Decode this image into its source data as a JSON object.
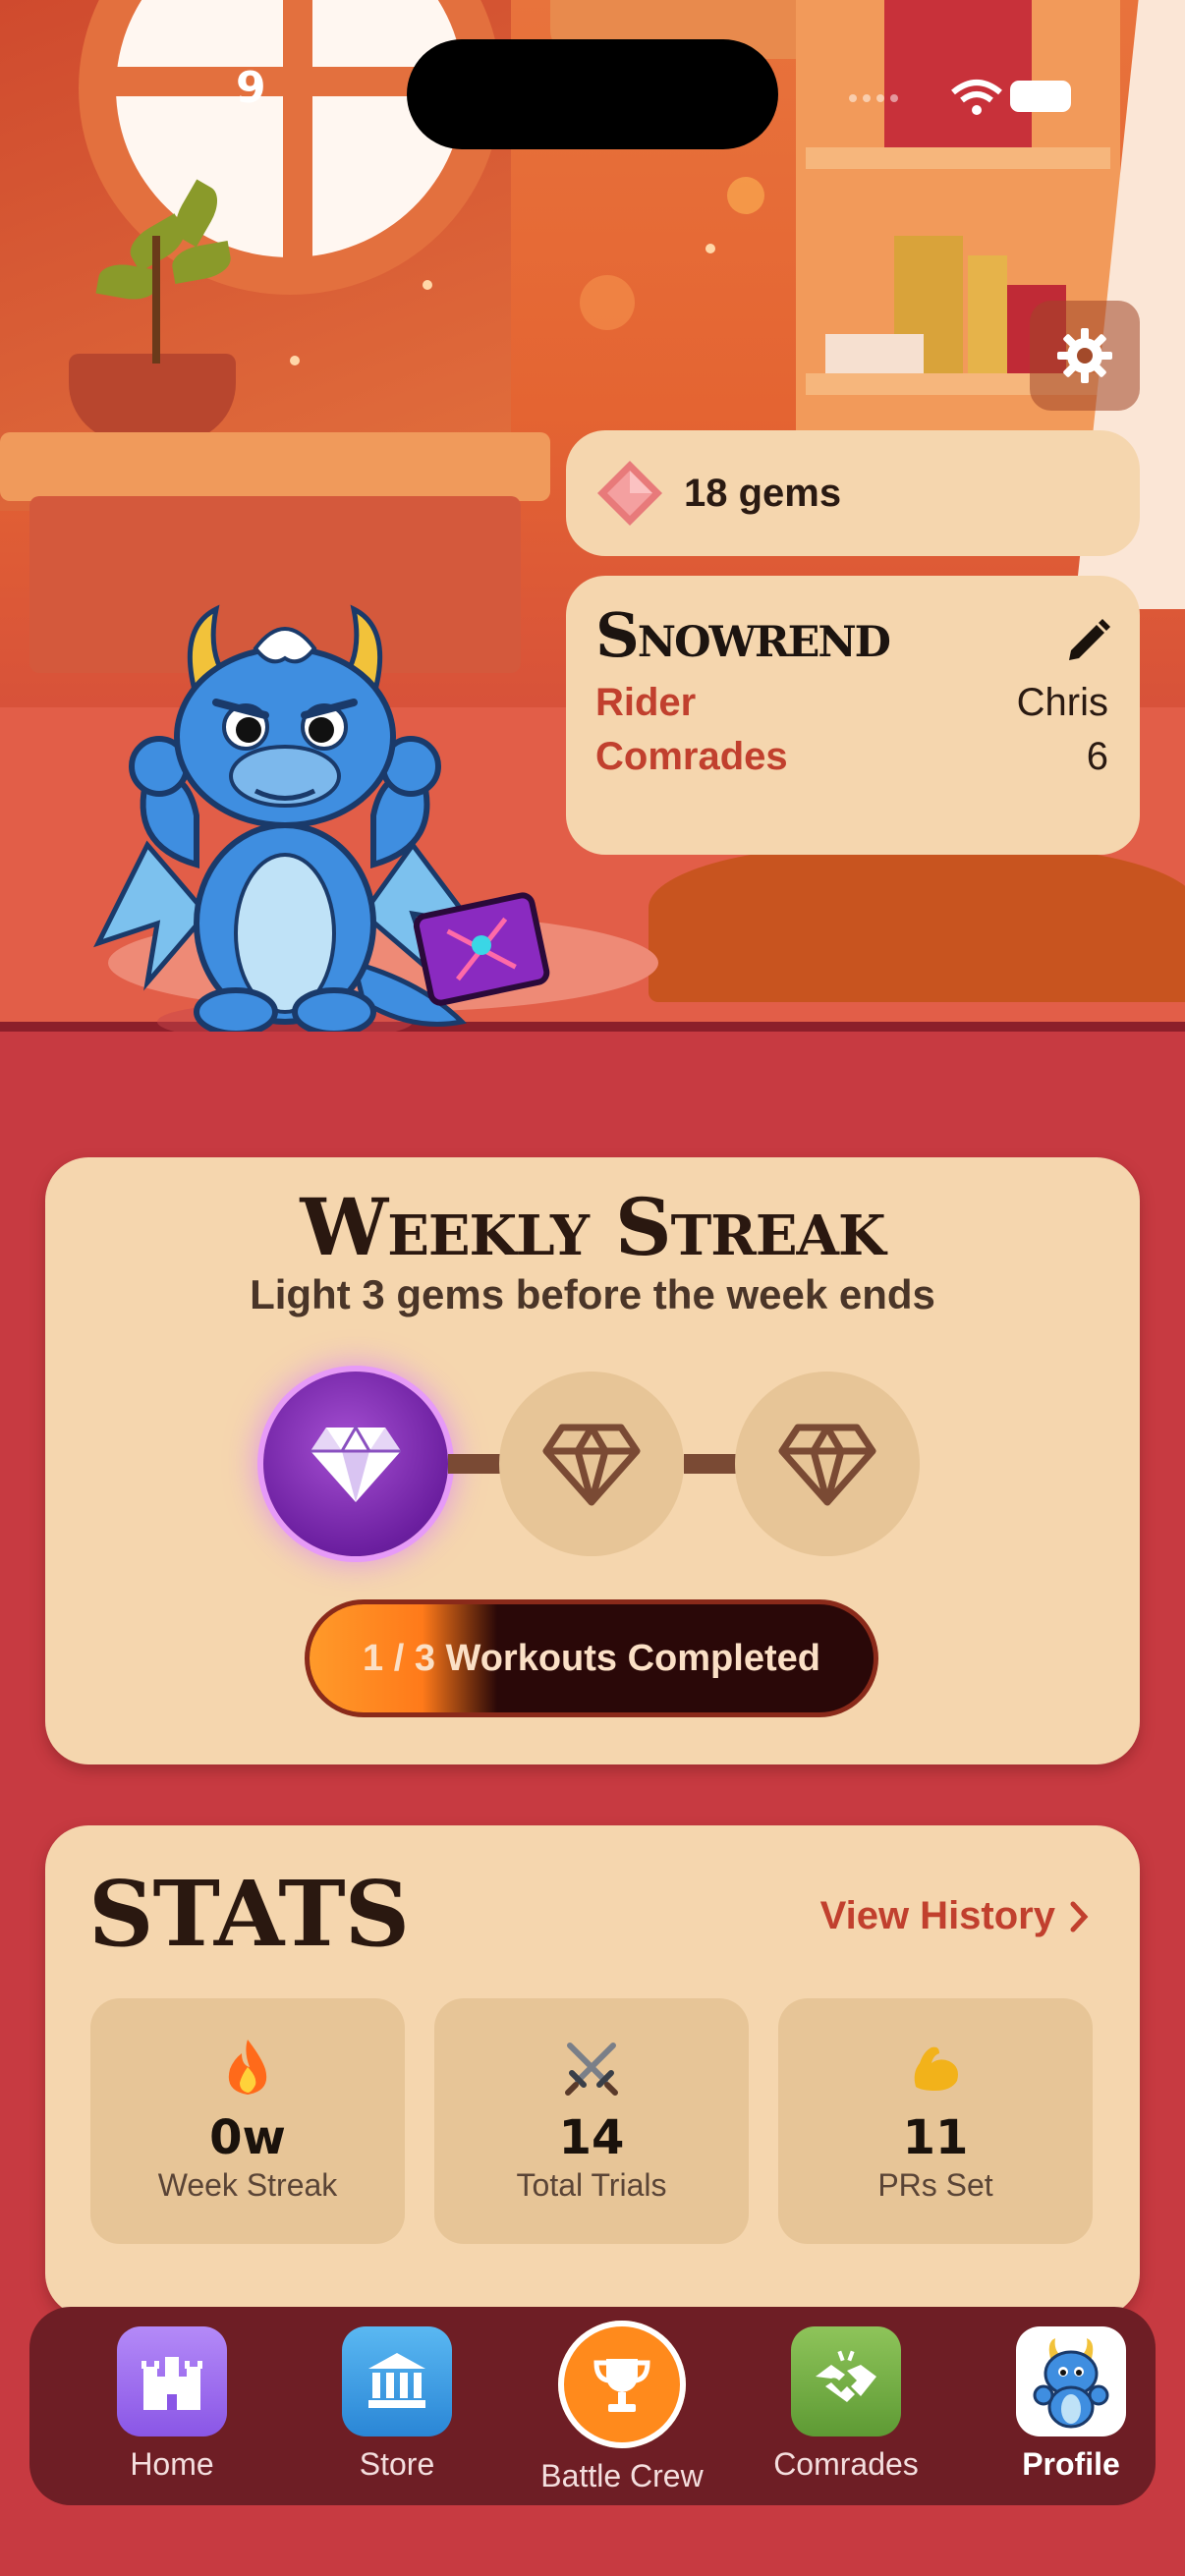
{
  "status_bar": {
    "time": "9"
  },
  "gems": {
    "label": "18 gems"
  },
  "profile": {
    "dragon_name": "Snowrend",
    "rider_label": "Rider",
    "rider_value": "Chris",
    "comrades_label": "Comrades",
    "comrades_value": "6"
  },
  "weekly_streak": {
    "title": "Weekly Streak",
    "subtitle": "Light 3 gems before the week ends",
    "gems_lit": 1,
    "gems_total": 3,
    "progress_label": "1 / 3 Workouts Completed",
    "progress_fraction": 0.333
  },
  "stats": {
    "title": "STATS",
    "view_history": "View History",
    "items": [
      {
        "icon": "fire-icon",
        "value": "0w",
        "label": "Week Streak"
      },
      {
        "icon": "crossed-swords-icon",
        "value": "14",
        "label": "Total Trials"
      },
      {
        "icon": "flexed-biceps-icon",
        "value": "11",
        "label": "PRs Set"
      }
    ]
  },
  "nav": {
    "items": [
      {
        "label": "Home",
        "icon": "castle-icon",
        "color": "#9d6cf0"
      },
      {
        "label": "Store",
        "icon": "bank-icon",
        "color": "#3a9ee6"
      },
      {
        "label": "Battle Crew",
        "icon": "trophy-icon",
        "color": "#ff8a1c"
      },
      {
        "label": "Comrades",
        "icon": "handshake-icon",
        "color": "#79b044"
      },
      {
        "label": "Profile",
        "icon": "dragon-avatar-icon",
        "color": "#ffffff"
      }
    ],
    "active": "Profile"
  }
}
